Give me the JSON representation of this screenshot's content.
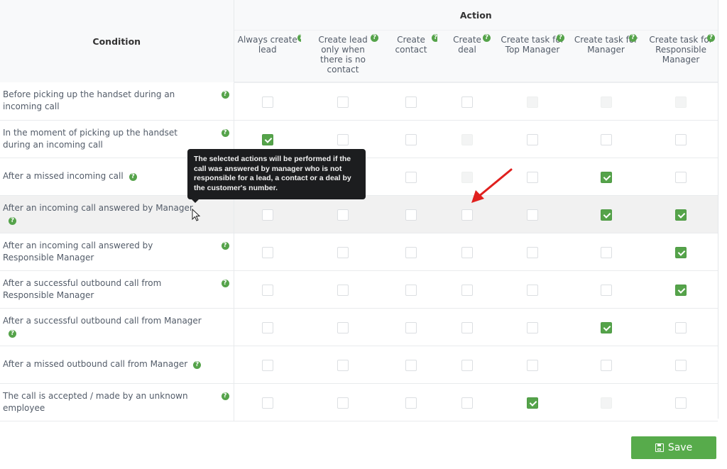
{
  "table": {
    "condition_header": "Condition",
    "action_header": "Action",
    "help_glyph": "?",
    "columns": [
      {
        "label": "Always create lead"
      },
      {
        "label": "Create lead only when there is no contact"
      },
      {
        "label": "Create contact"
      },
      {
        "label": "Create deal"
      },
      {
        "label": "Create task for Top Manager"
      },
      {
        "label": "Create task for Manager"
      },
      {
        "label": "Create task for Responsible Manager"
      }
    ],
    "rows": [
      {
        "label": "Before picking up the handset during an incoming call",
        "help": "right",
        "cells": [
          "unchecked",
          "unchecked",
          "unchecked",
          "unchecked",
          "disabled",
          "disabled",
          "disabled"
        ]
      },
      {
        "label": "In the moment of picking up the handset during an incoming call",
        "help": "right",
        "cells": [
          "checked",
          "unchecked",
          "unchecked",
          "disabled",
          "unchecked",
          "unchecked",
          "unchecked"
        ]
      },
      {
        "label": "After a missed incoming call",
        "help": "inline",
        "cells": [
          "unchecked",
          "unchecked",
          "unchecked",
          "disabled",
          "unchecked",
          "checked",
          "unchecked"
        ]
      },
      {
        "label": "After an incoming call answered by Manager",
        "help": "inline",
        "highlighted": true,
        "cells": [
          "unchecked",
          "unchecked",
          "unchecked",
          "unchecked",
          "unchecked",
          "checked",
          "checked"
        ]
      },
      {
        "label": "After an incoming call answered by Responsible Manager",
        "help": "right",
        "cells": [
          "unchecked",
          "unchecked",
          "unchecked",
          "unchecked",
          "unchecked",
          "unchecked",
          "checked"
        ]
      },
      {
        "label": "After a successful outbound call from Responsible Manager",
        "help": "right",
        "cells": [
          "unchecked",
          "unchecked",
          "unchecked",
          "unchecked",
          "unchecked",
          "unchecked",
          "checked"
        ]
      },
      {
        "label": "After a successful outbound call from Manager",
        "help": "inline",
        "cells": [
          "unchecked",
          "unchecked",
          "unchecked",
          "unchecked",
          "unchecked",
          "checked",
          "unchecked"
        ]
      },
      {
        "label": "After a missed outbound call from Manager",
        "help": "inline",
        "cells": [
          "unchecked",
          "unchecked",
          "unchecked",
          "unchecked",
          "unchecked",
          "unchecked",
          "unchecked"
        ]
      },
      {
        "label": "The call is accepted / made by an unknown employee",
        "help": "right",
        "cells": [
          "unchecked",
          "unchecked",
          "unchecked",
          "unchecked",
          "checked",
          "disabled",
          "unchecked"
        ]
      }
    ]
  },
  "tooltip": {
    "text": "The selected actions will be performed if the call was answered by manager who is not responsible for a lead, a contact or a deal by the customer's number."
  },
  "save_button": {
    "label": "Save",
    "icon": "floppy-disk-icon"
  },
  "colors": {
    "accent": "#55a34a",
    "tooltip_bg": "#1c1d1f",
    "annotation_arrow": "#e0201e"
  }
}
